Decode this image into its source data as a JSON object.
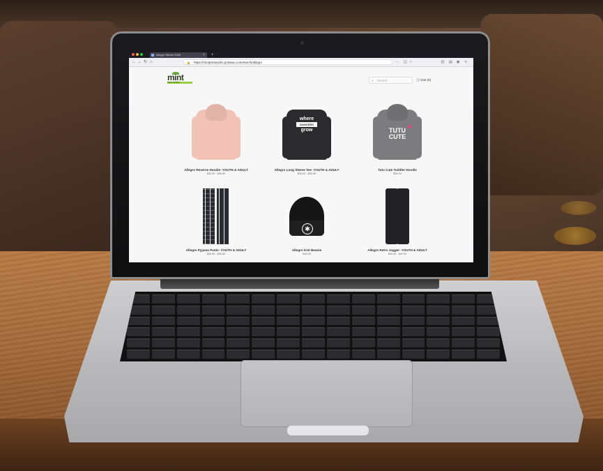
{
  "browser": {
    "tab_title": "Allegro Winter 2020",
    "tab_close": "×",
    "new_tab": "+",
    "url": "https://mintprintworks.printavo.com/merch/allegro",
    "back": "←",
    "forward": "→",
    "reload": "↻",
    "home": "⌂",
    "page_actions": "···",
    "bookmark": "☆",
    "window_dot_colors": [
      "#ff5f57",
      "#febc2e",
      "#28c840"
    ]
  },
  "store": {
    "logo_text": "mint",
    "logo_sub": "PRINT WORKS",
    "search_placeholder": "Search",
    "cart_label": "Cart (0)"
  },
  "products": [
    {
      "name": "Allegro Reverse Hoodie- YOUTH & ADULT",
      "price": "$33.00 - $36.00",
      "color": "#f2c2b7"
    },
    {
      "name": "Allegro Long Sleeve Tee- YOUTH & ADULT",
      "price": "$26.00 - $30.00",
      "color": "#2b2b2f",
      "print": [
        "where",
        "DANCERS",
        "grow"
      ]
    },
    {
      "name": "Tutu Cute Toddler Hoodie",
      "price": "$28.00",
      "color": "#7c7c80",
      "print": [
        "TUTU",
        "CUTE"
      ]
    },
    {
      "name": "Allegro Pyjama Pants- YOUTH & ADULT",
      "price": "$30.00 - $30.00",
      "color": "#2a2a33"
    },
    {
      "name": "Allegro Knit Beanie",
      "price": "$18.00",
      "color": "#151515",
      "print": [
        "✱"
      ]
    },
    {
      "name": "Allegro Retro Jogger- YOUTH & ADULT",
      "price": "$40.00 - $42.00",
      "color": "#222226"
    }
  ]
}
